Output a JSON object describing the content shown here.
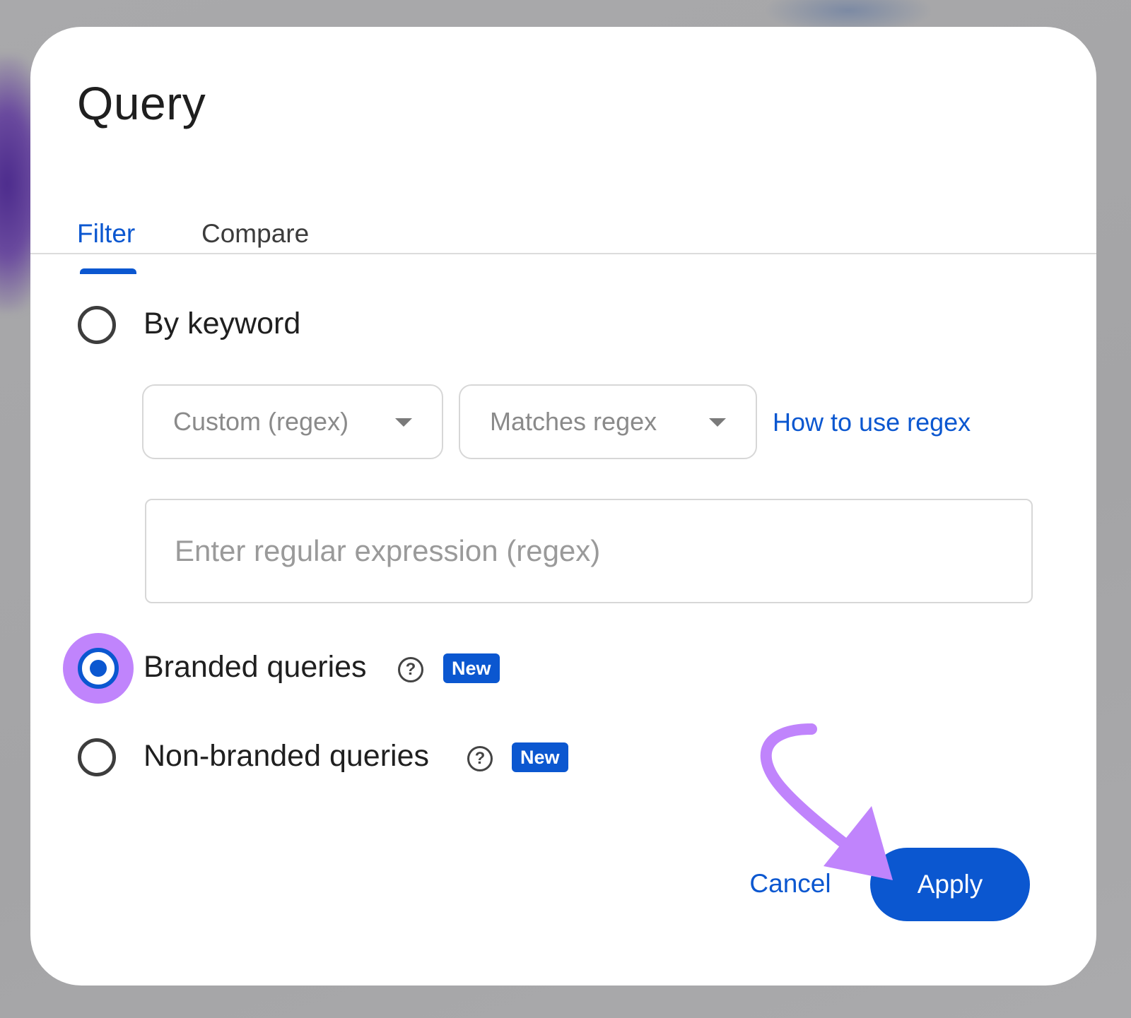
{
  "dialog": {
    "title": "Query",
    "tabs": [
      {
        "label": "Filter",
        "active": true
      },
      {
        "label": "Compare",
        "active": false
      }
    ],
    "options": {
      "by_keyword": {
        "label": "By keyword",
        "selected": false
      },
      "branded": {
        "label": "Branded queries",
        "selected": true,
        "badge": "New"
      },
      "non_branded": {
        "label": "Non-branded queries",
        "selected": false,
        "badge": "New"
      }
    },
    "keyword_filter": {
      "type_select": "Custom (regex)",
      "match_select": "Matches regex",
      "help_link": "How to use regex",
      "regex_placeholder": "Enter regular expression (regex)",
      "regex_value": ""
    },
    "actions": {
      "cancel": "Cancel",
      "apply": "Apply"
    }
  },
  "icons": {
    "help": "help-circle-icon",
    "dropdown": "caret-down-icon",
    "annotation": "curved-arrow-icon"
  },
  "colors": {
    "accent": "#0b57d0",
    "highlight": "#c084fc",
    "badge_bg": "#0b57d0"
  }
}
